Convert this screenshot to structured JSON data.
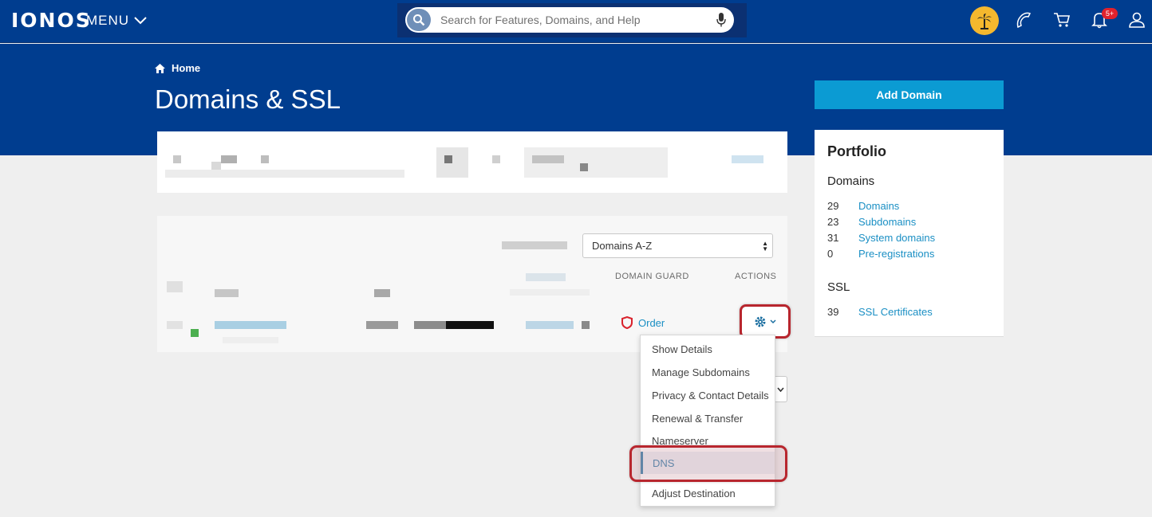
{
  "nav": {
    "logo": "IONOS",
    "menu_label": "MENU",
    "search_placeholder": "Search for Features, Domains, and Help",
    "notification_badge": "5+"
  },
  "header": {
    "breadcrumb": "Home",
    "title": "Domains & SSL",
    "add_domain_label": "Add Domain"
  },
  "domain_list": {
    "sort_value": "Domains A-Z",
    "columns": {
      "domain_guard": "DOMAIN GUARD",
      "actions": "ACTIONS"
    },
    "row": {
      "guard_action": "Order"
    }
  },
  "actions_menu": {
    "items": [
      "Show Details",
      "Manage Subdomains",
      "Privacy & Contact Details",
      "Renewal & Transfer",
      "Nameserver",
      "DNS",
      "Adjust Destination"
    ],
    "active": "DNS"
  },
  "portfolio": {
    "title": "Portfolio",
    "domains_heading": "Domains",
    "domains": [
      {
        "count": "29",
        "label": "Domains"
      },
      {
        "count": "23",
        "label": "Subdomains"
      },
      {
        "count": "31",
        "label": "System domains"
      },
      {
        "count": "0",
        "label": "Pre-registrations"
      }
    ],
    "ssl_heading": "SSL",
    "ssl": [
      {
        "count": "39",
        "label": "SSL Certificates"
      }
    ]
  },
  "colors": {
    "brand_blue": "#003d8f",
    "accent": "#0b9bd3",
    "link": "#1a8fc4",
    "highlight": "#b8262e"
  }
}
